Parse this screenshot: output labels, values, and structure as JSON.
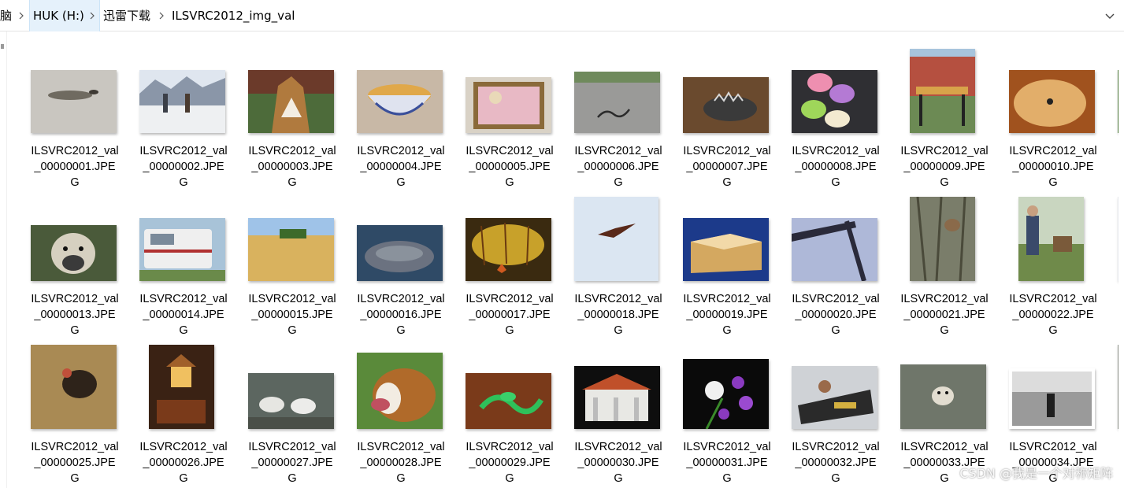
{
  "breadcrumb": {
    "items": [
      "脑",
      "HUK (H:)",
      "迅雷下载",
      "ILSVRC2012_img_val"
    ]
  },
  "files": [
    {
      "l1": "ILSVRC2012_val",
      "l2": "_00000001.JPE",
      "l3": "G"
    },
    {
      "l1": "ILSVRC2012_val",
      "l2": "_00000002.JPE",
      "l3": "G"
    },
    {
      "l1": "ILSVRC2012_val",
      "l2": "_00000003.JPE",
      "l3": "G"
    },
    {
      "l1": "ILSVRC2012_val",
      "l2": "_00000004.JPE",
      "l3": "G"
    },
    {
      "l1": "ILSVRC2012_val",
      "l2": "_00000005.JPE",
      "l3": "G"
    },
    {
      "l1": "ILSVRC2012_val",
      "l2": "_00000006.JPE",
      "l3": "G"
    },
    {
      "l1": "ILSVRC2012_val",
      "l2": "_00000007.JPE",
      "l3": "G"
    },
    {
      "l1": "ILSVRC2012_val",
      "l2": "_00000008.JPE",
      "l3": "G"
    },
    {
      "l1": "ILSVRC2012_val",
      "l2": "_00000009.JPE",
      "l3": "G"
    },
    {
      "l1": "ILSVRC2012_val",
      "l2": "_00000010.JPE",
      "l3": "G"
    },
    {
      "l1": "IL",
      "l2": "",
      "l3": ""
    },
    {
      "l1": "ILSVRC2012_val",
      "l2": "_00000013.JPE",
      "l3": "G"
    },
    {
      "l1": "ILSVRC2012_val",
      "l2": "_00000014.JPE",
      "l3": "G"
    },
    {
      "l1": "ILSVRC2012_val",
      "l2": "_00000015.JPE",
      "l3": "G"
    },
    {
      "l1": "ILSVRC2012_val",
      "l2": "_00000016.JPE",
      "l3": "G"
    },
    {
      "l1": "ILSVRC2012_val",
      "l2": "_00000017.JPE",
      "l3": "G"
    },
    {
      "l1": "ILSVRC2012_val",
      "l2": "_00000018.JPE",
      "l3": "G"
    },
    {
      "l1": "ILSVRC2012_val",
      "l2": "_00000019.JPE",
      "l3": "G"
    },
    {
      "l1": "ILSVRC2012_val",
      "l2": "_00000020.JPE",
      "l3": "G"
    },
    {
      "l1": "ILSVRC2012_val",
      "l2": "_00000021.JPE",
      "l3": "G"
    },
    {
      "l1": "ILSVRC2012_val",
      "l2": "_00000022.JPE",
      "l3": "G"
    },
    {
      "l1": "IL",
      "l2": "",
      "l3": ""
    },
    {
      "l1": "ILSVRC2012_val",
      "l2": "_00000025.JPE",
      "l3": "G"
    },
    {
      "l1": "ILSVRC2012_val",
      "l2": "_00000026.JPE",
      "l3": "G"
    },
    {
      "l1": "ILSVRC2012_val",
      "l2": "_00000027.JPE",
      "l3": "G"
    },
    {
      "l1": "ILSVRC2012_val",
      "l2": "_00000028.JPE",
      "l3": "G"
    },
    {
      "l1": "ILSVRC2012_val",
      "l2": "_00000029.JPE",
      "l3": "G"
    },
    {
      "l1": "ILSVRC2012_val",
      "l2": "_00000030.JPE",
      "l3": "G"
    },
    {
      "l1": "ILSVRC2012_val",
      "l2": "_00000031.JPE",
      "l3": "G"
    },
    {
      "l1": "ILSVRC2012_val",
      "l2": "_00000032.JPE",
      "l3": "G"
    },
    {
      "l1": "ILSVRC2012_val",
      "l2": "_00000033.JPE",
      "l3": "G"
    },
    {
      "l1": "ILSVRC2012_val",
      "l2": "_00000034.JPE",
      "l3": "G"
    },
    {
      "l1": "IL",
      "l2": "",
      "l3": ""
    }
  ],
  "watermark": "CSDN @我是一个对称矩阵"
}
